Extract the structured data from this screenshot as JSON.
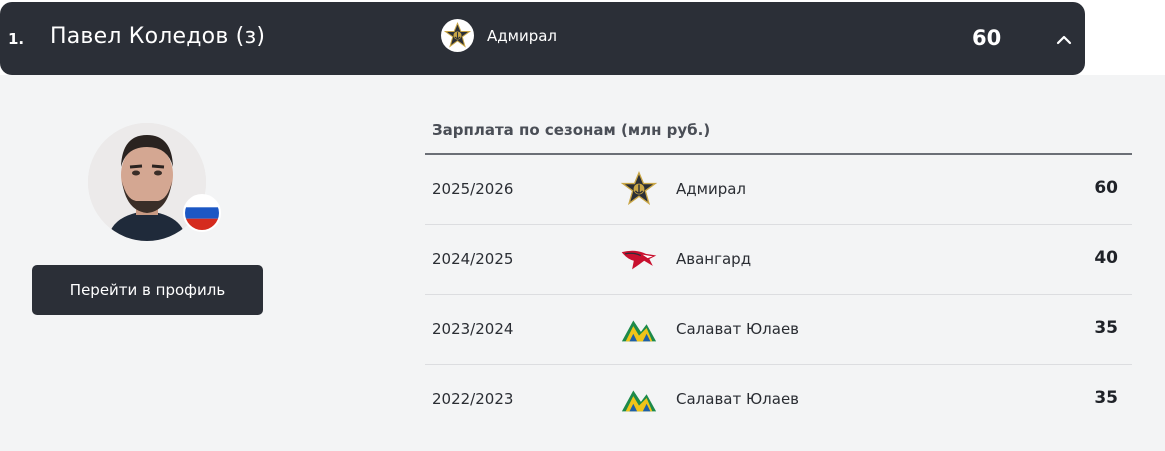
{
  "header": {
    "rank": "1.",
    "player_name": "Павел Коледов (з)",
    "team_name": "Адмирал",
    "salary": "60",
    "collapse_icon": "chevron-up-icon"
  },
  "profile": {
    "avatar_icon": "player-photo",
    "flag_icon": "russia-flag-icon",
    "button_label": "Перейти в профиль"
  },
  "salary_table": {
    "title": "Зарплата по сезонам (млн руб.)",
    "rows": [
      {
        "season": "2025/2026",
        "team": "Адмирал",
        "logo": "admiral-logo-icon",
        "amount": "60"
      },
      {
        "season": "2024/2025",
        "team": "Авангард",
        "logo": "avangard-logo-icon",
        "amount": "40"
      },
      {
        "season": "2023/2024",
        "team": "Салават Юлаев",
        "logo": "salavat-logo-icon",
        "amount": "35"
      },
      {
        "season": "2022/2023",
        "team": "Салават Юлаев",
        "logo": "salavat-logo-icon",
        "amount": "35"
      }
    ]
  },
  "colors": {
    "header_bg": "#2b2f37",
    "panel_bg": "#f3f4f5",
    "text_dark": "#1f2228"
  }
}
